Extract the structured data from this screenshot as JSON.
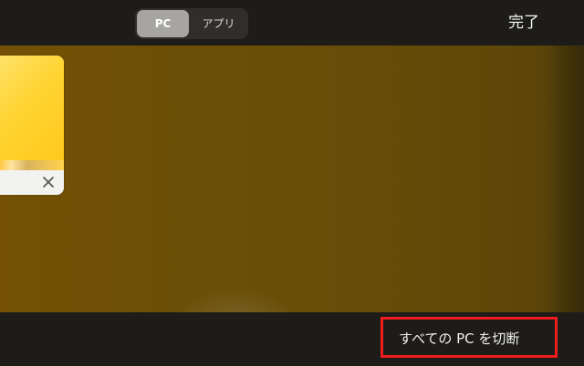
{
  "top_bar": {
    "segments": [
      {
        "label": "PC",
        "selected": true
      },
      {
        "label": "アプリ",
        "selected": false
      }
    ],
    "done_label": "完了"
  },
  "sessions": [
    {
      "close_icon": "close-icon"
    }
  ],
  "bottom_bar": {
    "disconnect_label": "すべての PC を切断"
  },
  "colors": {
    "top_bar": "#1d1c19",
    "background": "#6a4f06",
    "segment_selected": "#a6a5a1",
    "highlight": "#ee1d1d"
  }
}
